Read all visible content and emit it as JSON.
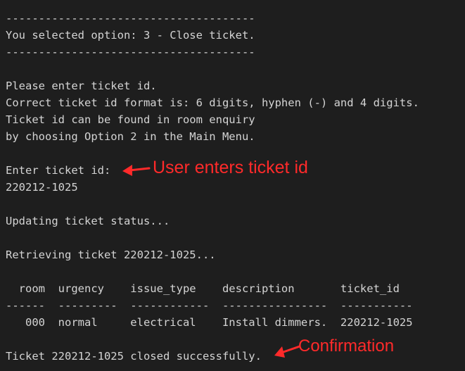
{
  "terminal": {
    "lines": [
      "--------------------------------------",
      "You selected option: 3 - Close ticket.",
      "--------------------------------------",
      "Please enter ticket id.",
      "Correct ticket id format is: 6 digits, hyphen (-) and 4 digits.",
      "Ticket id can be found in room enquiry",
      "by choosing Option 2 in the Main Menu.",
      "Enter ticket id:",
      "220212-1025",
      "Updating ticket status...",
      "Retrieving ticket 220212-1025...",
      "  room  urgency    issue_type    description       ticket_id",
      "------  ---------  ------------  ----------------  -----------",
      "   000  normal     electrical    Install dimmers.  220212-1025",
      "Ticket 220212-1025 closed successfully."
    ]
  },
  "annotations": {
    "user_input": "User enters ticket id",
    "confirmation": "Confirmation",
    "color": "#ff2a2a"
  }
}
